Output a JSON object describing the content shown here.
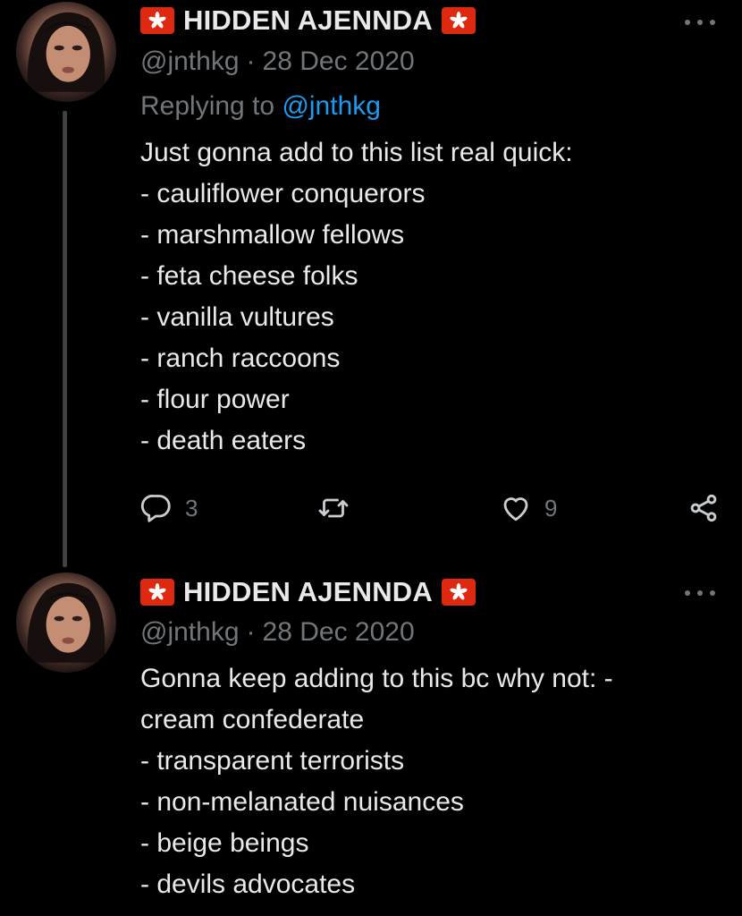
{
  "tweets": [
    {
      "display_name": "HIDDEN AJENNDA",
      "handle": "@jnthkg",
      "separator": "·",
      "date": "28 Dec 2020",
      "replying_prefix": "Replying to",
      "replying_to": "@jnthkg",
      "lines": [
        "Just gonna add to this list real quick:",
        "- cauliflower conquerors",
        "- marshmallow fellows",
        "- feta cheese folks",
        "- vanilla vultures",
        "- ranch raccoons",
        "- flour power",
        "- death eaters"
      ],
      "actions": {
        "reply_icon": "reply-bubble-icon",
        "reply_count": "3",
        "retweet_icon": "retweet-arrows-icon",
        "like_icon": "heart-icon",
        "like_count": "9",
        "share_icon": "share-nodes-icon"
      }
    },
    {
      "display_name": "HIDDEN AJENNDA",
      "handle": "@jnthkg",
      "separator": "·",
      "date": "28 Dec 2020",
      "lines": [
        "Gonna keep adding to this bc why not: -",
        "cream confederate",
        "- transparent terrorists",
        "- non-melanated nuisances",
        "- beige beings",
        "- devils advocates"
      ]
    }
  ],
  "icons": {
    "flag": "hong-kong-flag-icon",
    "more": "more-dots-icon"
  },
  "colors": {
    "background": "#000000",
    "primary_text": "#e7e9ea",
    "secondary_text": "#71767b",
    "mention": "#1d9bf0",
    "flag_red": "#de2910",
    "thread_line": "#3e4144"
  }
}
